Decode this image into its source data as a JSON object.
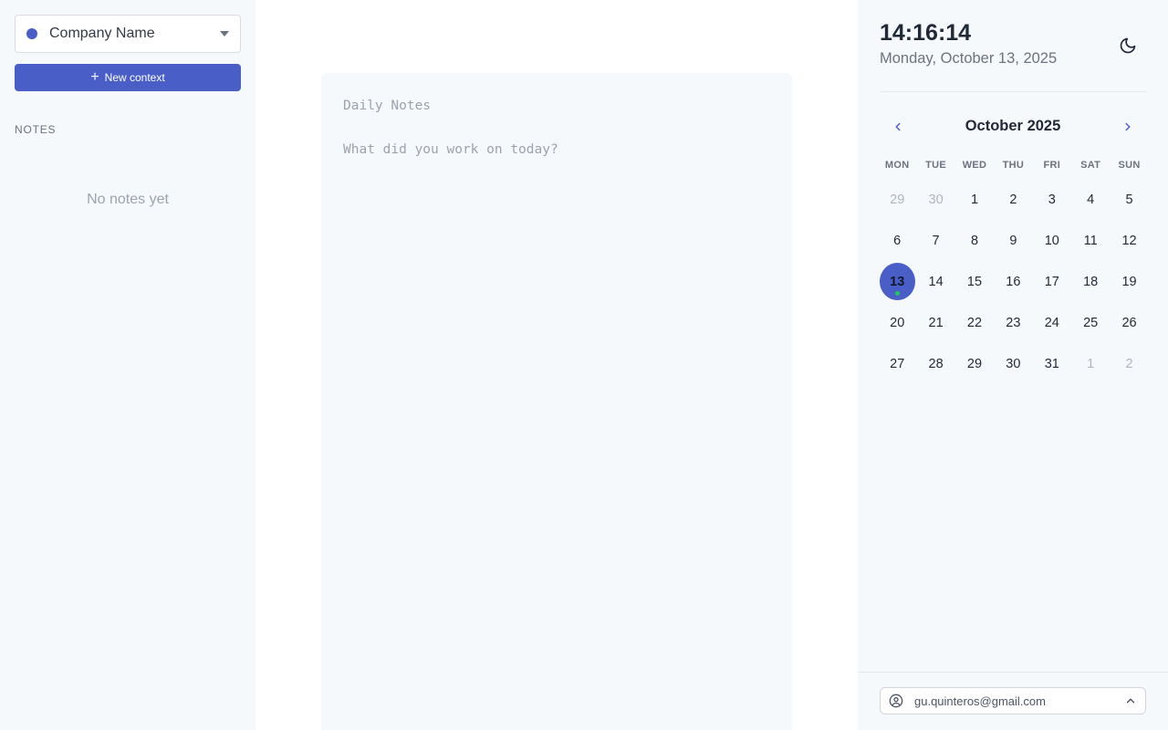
{
  "colors": {
    "accent": "#4a5ec8",
    "today_dot": "#22c55e"
  },
  "sidebar": {
    "context_select": {
      "value": "Company Name",
      "dot_color": "#4a5ec8",
      "icon": "chevron-down-icon"
    },
    "new_context_label": "New context",
    "notes_heading": "NOTES",
    "empty_message": "No notes yet"
  },
  "editor": {
    "title_placeholder": "Daily Notes",
    "body_placeholder": "What did you work on today?"
  },
  "header": {
    "time": "14:16:14",
    "date": "Monday, October 13, 2025",
    "theme_icon": "moon-icon"
  },
  "calendar": {
    "month_label": "October 2025",
    "prev_icon": "chevron-left-icon",
    "next_icon": "chevron-right-icon",
    "weekdays": [
      "MON",
      "TUE",
      "WED",
      "THU",
      "FRI",
      "SAT",
      "SUN"
    ],
    "weeks": [
      [
        {
          "d": "29",
          "out": true
        },
        {
          "d": "30",
          "out": true
        },
        {
          "d": "1"
        },
        {
          "d": "2"
        },
        {
          "d": "3"
        },
        {
          "d": "4"
        },
        {
          "d": "5"
        }
      ],
      [
        {
          "d": "6"
        },
        {
          "d": "7"
        },
        {
          "d": "8"
        },
        {
          "d": "9"
        },
        {
          "d": "10"
        },
        {
          "d": "11"
        },
        {
          "d": "12"
        }
      ],
      [
        {
          "d": "13",
          "today": true
        },
        {
          "d": "14"
        },
        {
          "d": "15"
        },
        {
          "d": "16"
        },
        {
          "d": "17"
        },
        {
          "d": "18"
        },
        {
          "d": "19"
        }
      ],
      [
        {
          "d": "20"
        },
        {
          "d": "21"
        },
        {
          "d": "22"
        },
        {
          "d": "23"
        },
        {
          "d": "24"
        },
        {
          "d": "25"
        },
        {
          "d": "26"
        }
      ],
      [
        {
          "d": "27"
        },
        {
          "d": "28"
        },
        {
          "d": "29"
        },
        {
          "d": "30"
        },
        {
          "d": "31"
        },
        {
          "d": "1",
          "out": true
        },
        {
          "d": "2",
          "out": true
        }
      ]
    ]
  },
  "account": {
    "email": "gu.quinteros@gmail.com",
    "icon": "user-circle-icon",
    "toggle_icon": "chevron-up-icon"
  }
}
